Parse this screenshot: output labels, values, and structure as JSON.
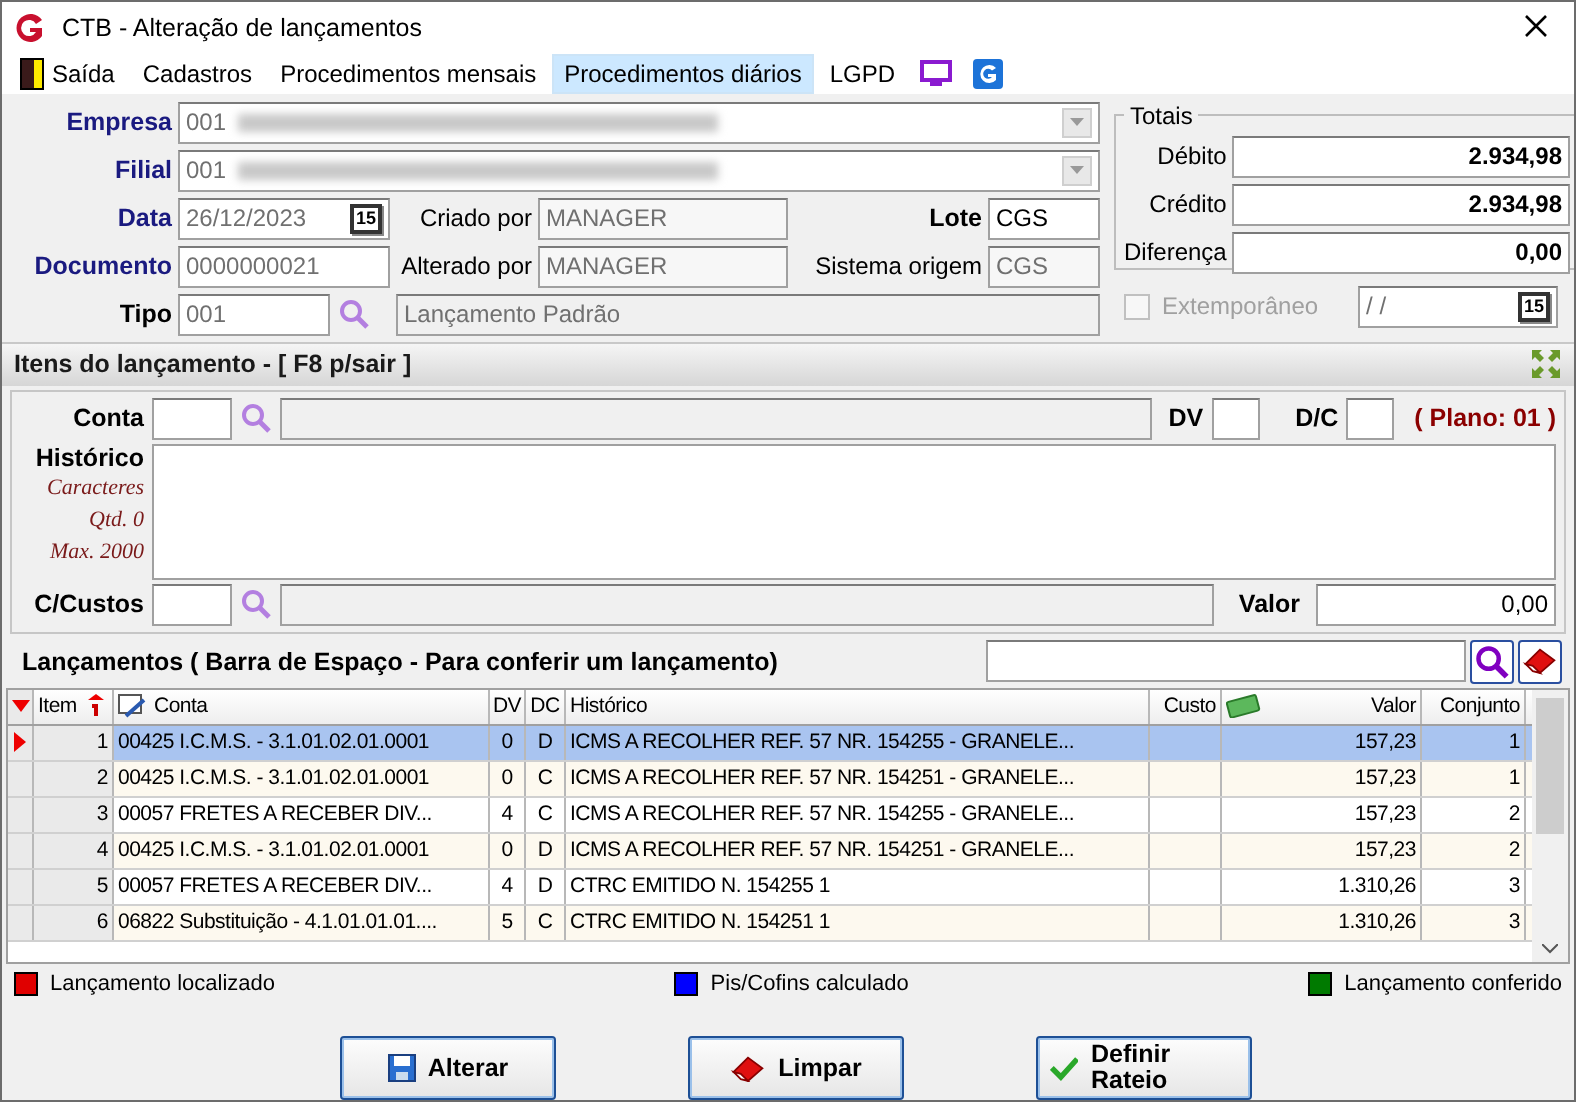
{
  "window": {
    "title": "CTB - Alteração de lançamentos"
  },
  "menu": [
    {
      "label": "Saída",
      "kind": "exit",
      "selected": false
    },
    {
      "label": "Cadastros",
      "kind": "text",
      "selected": false
    },
    {
      "label": "Procedimentos mensais",
      "kind": "text",
      "selected": false
    },
    {
      "label": "Procedimentos diários",
      "kind": "text",
      "selected": true
    },
    {
      "label": "LGPD",
      "kind": "text",
      "selected": false
    }
  ],
  "header": {
    "empresa": {
      "label": "Empresa",
      "value": "001"
    },
    "filial": {
      "label": "Filial",
      "value": "001"
    },
    "data": {
      "label": "Data",
      "value": "26/12/2023",
      "calendar_label": "15"
    },
    "documento": {
      "label": "Documento",
      "value": "0000000021"
    },
    "tipo": {
      "label": "Tipo",
      "value": "001",
      "description": "Lançamento Padrão"
    },
    "criado_por": {
      "label": "Criado por",
      "value": "MANAGER"
    },
    "alterado_por": {
      "label": "Alterado por",
      "value": "MANAGER"
    },
    "lote": {
      "label": "Lote",
      "value": "CGS"
    },
    "sistema_origem": {
      "label": "Sistema origem",
      "value": "CGS"
    }
  },
  "totais": {
    "title": "Totais",
    "rows": [
      {
        "label": "Débito",
        "value": "2.934,98"
      },
      {
        "label": "Crédito",
        "value": "2.934,98"
      },
      {
        "label": "Diferença",
        "value": "0,00"
      }
    ]
  },
  "extemporaneo": {
    "label": "Extemporâneo",
    "checked": false,
    "disabled": true,
    "date": "/ /",
    "calendar_label": "15"
  },
  "items_section": {
    "title": "Itens do lançamento - [ F8 p/sair ]",
    "conta": {
      "label": "Conta"
    },
    "dv": {
      "label": "DV"
    },
    "dc": {
      "label": "D/C"
    },
    "plano": "( Plano: 01 )",
    "historico": {
      "label": "Histórico",
      "counter": [
        "Caracteres",
        "Qtd. 0",
        "Max. 2000"
      ]
    },
    "custos": {
      "label": "C/Custos"
    },
    "valor": {
      "label": "Valor",
      "value": "0,00"
    }
  },
  "lancamentos": {
    "label": "Lançamentos ( Barra de Espaço - Para conferir um lançamento)"
  },
  "table": {
    "columns": [
      "Item",
      "Conta",
      "DV",
      "DC",
      "Histórico",
      "Custo",
      "Valor",
      "Conjunto"
    ],
    "rows": [
      {
        "selected": true,
        "cells": [
          "1",
          "00425 I.C.M.S. - 3.1.01.02.01.0001",
          "0",
          "D",
          "ICMS A RECOLHER REF. 57 NR. 154255 - GRANELE...",
          "",
          "157,23",
          "1"
        ]
      },
      {
        "selected": false,
        "cells": [
          "2",
          "00425 I.C.M.S. - 3.1.01.02.01.0001",
          "0",
          "C",
          "ICMS A RECOLHER REF. 57 NR. 154251 - GRANELE...",
          "",
          "157,23",
          "1"
        ]
      },
      {
        "selected": false,
        "cells": [
          "3",
          "00057 FRETES A RECEBER DIV...",
          "4",
          "C",
          "ICMS A RECOLHER REF. 57 NR. 154255 - GRANELE...",
          "",
          "157,23",
          "2"
        ]
      },
      {
        "selected": false,
        "cells": [
          "4",
          "00425 I.C.M.S. - 3.1.01.02.01.0001",
          "0",
          "D",
          "ICMS A RECOLHER REF. 57 NR. 154251 - GRANELE...",
          "",
          "157,23",
          "2"
        ]
      },
      {
        "selected": false,
        "cells": [
          "5",
          "00057 FRETES A RECEBER DIV...",
          "4",
          "D",
          "CTRC EMITIDO N. 154255 1",
          "",
          "1.310,26",
          "3"
        ]
      },
      {
        "selected": false,
        "cells": [
          "6",
          "06822 Substituição - 4.1.01.01.01....",
          "5",
          "C",
          "CTRC EMITIDO N. 154251 1",
          "",
          "1.310,26",
          "3"
        ]
      }
    ]
  },
  "legend": [
    {
      "label": "Lançamento localizado",
      "color": "#e00000"
    },
    {
      "label": "Pis/Cofins calculado",
      "color": "#0000ff"
    },
    {
      "label": "Lançamento conferido",
      "color": "#007a00"
    }
  ],
  "buttons": [
    {
      "label": "Alterar",
      "kind": "save"
    },
    {
      "label": "Limpar",
      "kind": "clear"
    },
    {
      "label": "Definir Rateio",
      "kind": "confirm"
    }
  ]
}
